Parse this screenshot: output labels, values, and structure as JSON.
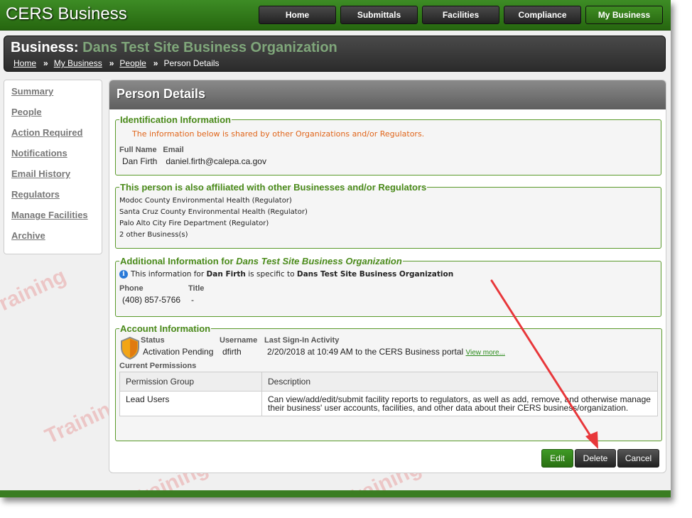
{
  "app": {
    "title": "CERS Business"
  },
  "nav": [
    {
      "label": "Home"
    },
    {
      "label": "Submittals"
    },
    {
      "label": "Facilities"
    },
    {
      "label": "Compliance"
    },
    {
      "label": "My Business",
      "active": true
    }
  ],
  "business": {
    "prefix": "Business:",
    "name": "Dans Test Site Business Organization"
  },
  "breadcrumb": [
    "Home",
    "My Business",
    "People",
    "Person Details"
  ],
  "sidebar": [
    "Summary",
    "People",
    "Action Required",
    "Notifications",
    "Email History",
    "Regulators",
    "Manage Facilities",
    "Archive"
  ],
  "page": {
    "title": "Person Details"
  },
  "identification": {
    "legend": "Identification Information",
    "notice": "The information below is shared by other Organizations and/or Regulators.",
    "full_name_label": "Full Name",
    "email_label": "Email",
    "full_name": "Dan Firth",
    "email": "daniel.firth@calepa.ca.gov"
  },
  "affiliations": {
    "legend": "This person is also affiliated with other Businesses and/or Regulators",
    "items": [
      "Modoc County Environmental Health (Regulator)",
      "Santa Cruz County Environmental Health (Regulator)",
      "Palo Alto City Fire Department (Regulator)",
      "2 other Business(s)"
    ]
  },
  "additional": {
    "legend_prefix": "Additional Information for ",
    "legend_org": "Dans Test Site Business Organization",
    "info_a": "This information for ",
    "info_name": "Dan Firth",
    "info_b": " is specific to ",
    "info_org": "Dans Test Site Business Organization",
    "phone_label": "Phone",
    "title_label": "Title",
    "phone": "(408) 857-5766",
    "title": "-"
  },
  "account": {
    "legend": "Account Information",
    "status_label": "Status",
    "username_label": "Username",
    "signin_label": "Last Sign-In Activity",
    "status": "Activation Pending",
    "username": "dfirth",
    "signin": "2/20/2018 at 10:49 AM to the CERS Business portal",
    "view_more": "View more...",
    "permissions_label": "Current Permissions",
    "columns": [
      "Permission Group",
      "Description"
    ],
    "rows": [
      [
        "Lead Users",
        "Can view/add/edit/submit facility reports to regulators, as well as add, remove, and otherwise manage their business' user accounts, facilities, and other data about their CERS business/organization."
      ]
    ]
  },
  "buttons": {
    "edit": "Edit",
    "delete": "Delete",
    "cancel": "Cancel"
  },
  "watermark": "Training",
  "colors": {
    "brand_green": "#2f7518",
    "annotation_arrow": "#e8373a"
  }
}
